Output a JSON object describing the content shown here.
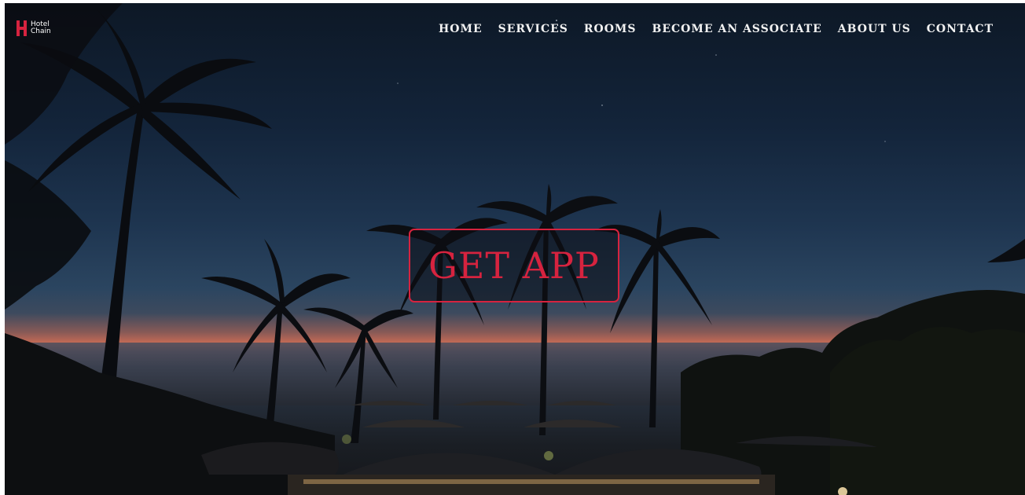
{
  "brand": {
    "name": "Hotel\nChain",
    "accent_color": "#d6233f"
  },
  "nav": {
    "items": [
      {
        "label": "HOME"
      },
      {
        "label": "SERVICES"
      },
      {
        "label": "ROOMS"
      },
      {
        "label": "BECOME AN ASSOCIATE"
      },
      {
        "label": "ABOUT US"
      },
      {
        "label": "CONTACT"
      }
    ]
  },
  "hero": {
    "cta_label": "GET APP",
    "background": "night-beach-palm-trees-photo"
  }
}
